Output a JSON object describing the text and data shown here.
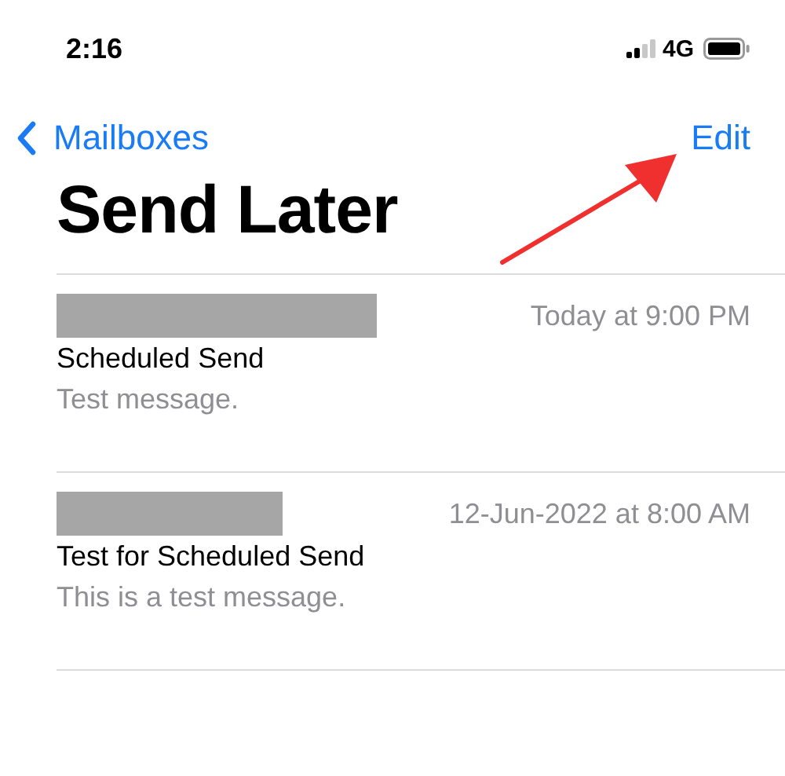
{
  "status_bar": {
    "time": "2:16",
    "network": "4G"
  },
  "nav": {
    "back_label": "Mailboxes",
    "action": "Edit"
  },
  "title": "Send Later",
  "messages": [
    {
      "date": "Today at 9:00 PM",
      "subject": "Scheduled Send",
      "preview": "Test message."
    },
    {
      "date": "12-Jun-2022 at 8:00 AM",
      "subject": "Test for Scheduled Send",
      "preview": "This is a test message."
    }
  ]
}
